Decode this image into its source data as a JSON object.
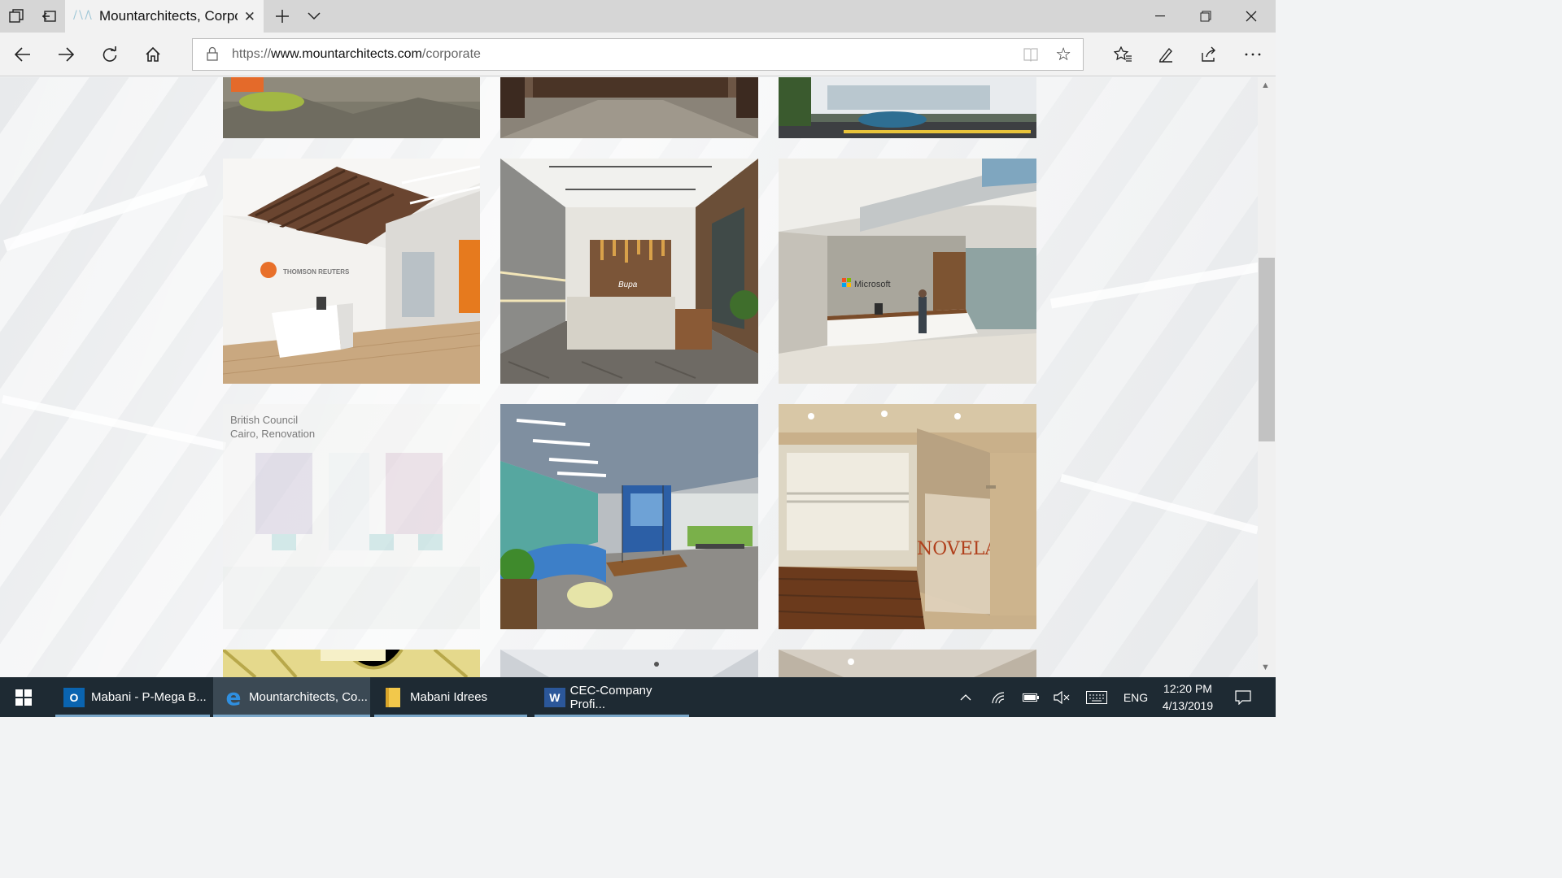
{
  "browser": {
    "tab_title": "Mountarchitects, Corpo",
    "favicon_text": "/ \\ /\\",
    "url_prefix": "https://",
    "url_domain": "www.mountarchitects.com",
    "url_path": "/corporate"
  },
  "page": {
    "caption_title": "British Council",
    "caption_sub": "Cairo, Renovation",
    "tile_logos": {
      "thomson": "THOMSON REUTERS",
      "bupa": "Bupa",
      "microsoft": "Microsoft",
      "novelari": "NOVELARI"
    }
  },
  "taskbar": {
    "items": [
      {
        "label": "Mabani - P-Mega B...",
        "icon": "outlook-icon"
      },
      {
        "label": "Mountarchitects, Co...",
        "icon": "edge-icon"
      },
      {
        "label": "Mabani Idrees",
        "icon": "folder-icon"
      },
      {
        "label": "CEC-Company Profi...",
        "icon": "word-icon"
      }
    ],
    "language": "ENG",
    "time": "12:20 PM",
    "date": "4/13/2019"
  },
  "colors": {
    "taskbar_bg": "#1e2a33",
    "tab_bg": "#d6d6d6",
    "active_tab_bg": "#f2f2f2",
    "accent": "#7aa6c8"
  }
}
